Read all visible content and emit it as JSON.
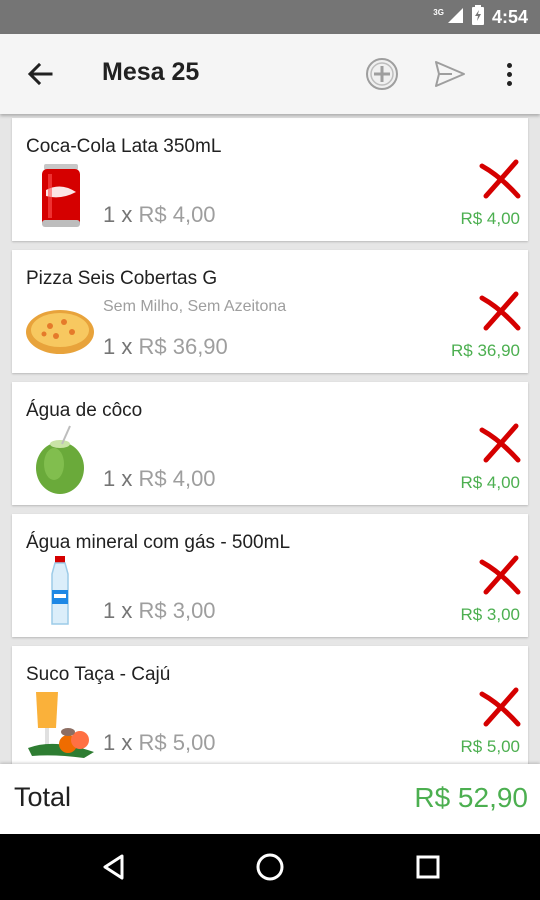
{
  "status_bar": {
    "network": "3G",
    "time": "4:54"
  },
  "app_bar": {
    "title": "Mesa 25"
  },
  "items": [
    {
      "name": "Coca-Cola Lata 350mL",
      "observation": "",
      "qty": "1 x",
      "unit_price": "R$ 4,00",
      "total": "R$ 4,00",
      "thumb_icon": "soda-can-icon"
    },
    {
      "name": "Pizza Seis Cobertas G",
      "observation": "Sem Milho, Sem Azeitona",
      "qty": "1 x",
      "unit_price": "R$ 36,90",
      "total": "R$ 36,90",
      "thumb_icon": "pizza-icon"
    },
    {
      "name": "Água de côco",
      "observation": "",
      "qty": "1 x",
      "unit_price": "R$ 4,00",
      "total": "R$ 4,00",
      "thumb_icon": "coconut-icon"
    },
    {
      "name": "Água mineral com gás - 500mL",
      "observation": "",
      "qty": "1 x",
      "unit_price": "R$ 3,00",
      "total": "R$ 3,00",
      "thumb_icon": "water-bottle-icon"
    },
    {
      "name": "Suco Taça - Cajú",
      "observation": "",
      "qty": "1 x",
      "unit_price": "R$ 5,00",
      "total": "R$ 5,00",
      "thumb_icon": "juice-glass-icon"
    }
  ],
  "footer": {
    "label": "Total",
    "value": "R$ 52,90"
  },
  "colors": {
    "accent_green": "#4caf50",
    "remove_red": "#d50000",
    "app_bar_bg": "#f5f5f5",
    "status_bar_bg": "#757575"
  }
}
